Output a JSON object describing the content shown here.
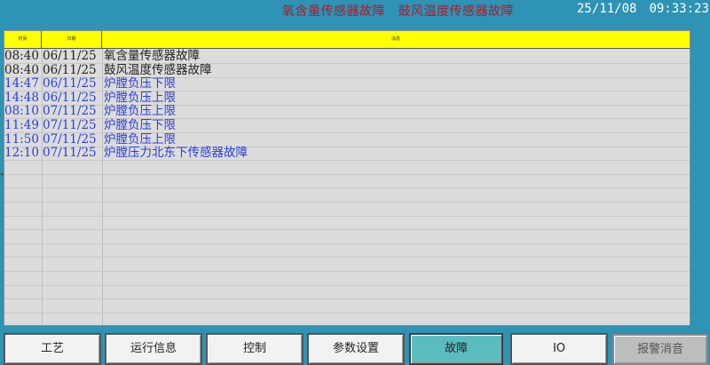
{
  "top_bar": {
    "active_alarm": "氧含量传感器故障　鼓风温度传感器故障",
    "date": "25/11/08",
    "time": "09:33:23"
  },
  "table": {
    "headers": [
      "时间",
      "日期",
      "消息"
    ],
    "rows": [
      {
        "time": "08:40",
        "date": "06/11/25",
        "message": "氧含量传感器故障",
        "color": "#222222"
      },
      {
        "time": "08:40",
        "date": "06/11/25",
        "message": "鼓风温度传感器故障",
        "color": "#222222"
      },
      {
        "time": "14:47",
        "date": "06/11/25",
        "message": "炉膛负压下限",
        "color": "#2b3fd6"
      },
      {
        "time": "14:48",
        "date": "06/11/25",
        "message": "炉膛负压上限",
        "color": "#2b3fd6"
      },
      {
        "time": "08:10",
        "date": "07/11/25",
        "message": "炉膛负压上限",
        "color": "#2b3fd6"
      },
      {
        "time": "11:49",
        "date": "07/11/25",
        "message": "炉膛负压下限",
        "color": "#2b3fd6"
      },
      {
        "time": "11:50",
        "date": "07/11/25",
        "message": "炉膛负压上限",
        "color": "#2b3fd6"
      },
      {
        "time": "12:10",
        "date": "07/11/25",
        "message": "炉膛压力北东下传感器故障",
        "color": "#2b3fd6"
      }
    ]
  },
  "nav_buttons": [
    {
      "label": "工艺",
      "state": "normal"
    },
    {
      "label": "运行信息",
      "state": "normal"
    },
    {
      "label": "控制",
      "state": "normal"
    },
    {
      "label": "参数设置",
      "state": "normal"
    },
    {
      "label": "故障",
      "state": "active"
    },
    {
      "label": "IO",
      "state": "normal"
    },
    {
      "label": "报警消音",
      "state": "disabled"
    }
  ],
  "colors": {
    "background": "#2e93b4",
    "header_yellow": "#ffff00",
    "alarm_red": "#b3182a",
    "active_button": "#5bbcc0"
  }
}
